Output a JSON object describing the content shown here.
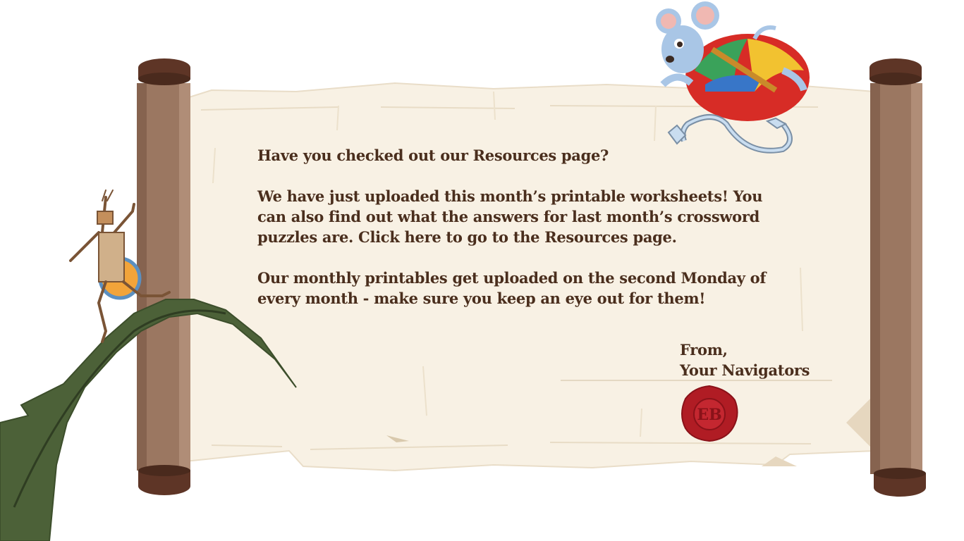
{
  "letter": {
    "question": "Have you checked out our Resources page?",
    "paragraph_upload_pre": "We have just uploaded this month’s printable worksheets! You can also find out what the answers for last month’s crossword puzzles are. ",
    "paragraph_upload_link": "Click here to go to the Resources page.",
    "paragraph_schedule": "Our monthly printables get uploaded on the second Monday of every month - make sure you keep an eye out for them!",
    "signoff_line1": "From,",
    "signoff_line2": "Your Navigators"
  },
  "icons": {
    "seal": "wax-seal-icon",
    "mouse": "mouse-character-icon",
    "robot": "stick-robot-character-icon",
    "leaf": "leaf-icon"
  },
  "colors": {
    "text": "#4a2e1d",
    "parchment": "#f8f1e4",
    "rod": "#9b7761",
    "seal": "#b01c24",
    "leaf": "#4c6138"
  }
}
